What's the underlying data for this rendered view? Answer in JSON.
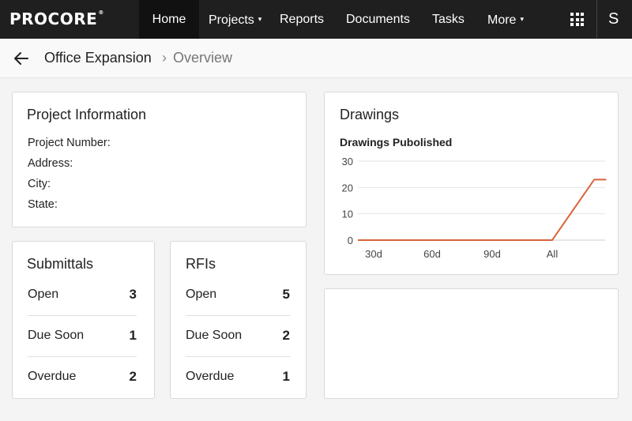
{
  "nav": {
    "logo": "PROCORE",
    "logo_mark": "®",
    "items": [
      {
        "label": "Home",
        "active": true
      },
      {
        "label": "Projects",
        "dropdown": true
      },
      {
        "label": "Reports"
      },
      {
        "label": "Documents"
      },
      {
        "label": "Tasks"
      },
      {
        "label": "More",
        "dropdown": true
      }
    ],
    "apps_icon": "grid-icon",
    "user_initial": "S"
  },
  "breadcrumb": {
    "back_icon": "arrow-left-icon",
    "project": "Office Expansion",
    "separator": "›",
    "page": "Overview"
  },
  "project_info": {
    "title": "Project Information",
    "fields": [
      "Project Number:",
      "Address:",
      "City:",
      "State:"
    ]
  },
  "submittals": {
    "title": "Submittals",
    "rows": [
      {
        "label": "Open",
        "value": "3"
      },
      {
        "label": "Due Soon",
        "value": "1"
      },
      {
        "label": "Overdue",
        "value": "2"
      }
    ]
  },
  "rfis": {
    "title": "RFIs",
    "rows": [
      {
        "label": "Open",
        "value": "5"
      },
      {
        "label": "Due Soon",
        "value": "2"
      },
      {
        "label": "Overdue",
        "value": "1"
      }
    ]
  },
  "drawings": {
    "title": "Drawings",
    "subtitle": "Drawings Pubolished",
    "line_color": "#d9643a"
  },
  "chart_data": {
    "type": "line",
    "title": "Drawings Pubolished",
    "categories": [
      "30d",
      "60d",
      "90d",
      "All"
    ],
    "x": [
      0,
      1,
      2,
      3,
      3.7,
      3.9
    ],
    "values": [
      0,
      0,
      0,
      0,
      23,
      23
    ],
    "yticks": [
      0,
      10,
      20,
      30
    ],
    "ylim": [
      0,
      30
    ],
    "grid": true,
    "legend": "none"
  }
}
